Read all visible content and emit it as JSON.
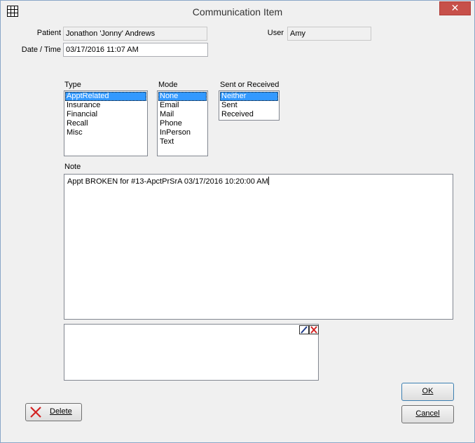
{
  "window": {
    "title": "Communication Item",
    "close_glyph": "✕"
  },
  "patient": {
    "label": "Patient",
    "value": "Jonathon 'Jonny' Andrews"
  },
  "user": {
    "label": "User",
    "value": "Amy"
  },
  "datetime": {
    "label": "Date / Time",
    "value": "03/17/2016  11:07 AM"
  },
  "type": {
    "label": "Type",
    "options": [
      "ApptRelated",
      "Insurance",
      "Financial",
      "Recall",
      "Misc"
    ],
    "selected": "ApptRelated"
  },
  "mode": {
    "label": "Mode",
    "options": [
      "None",
      "Email",
      "Mail",
      "Phone",
      "InPerson",
      "Text"
    ],
    "selected": "None"
  },
  "sent_received": {
    "label": "Sent or Received",
    "options": [
      "Neither",
      "Sent",
      "Received"
    ],
    "selected": "Neither"
  },
  "note": {
    "label": "Note",
    "value": "Appt BROKEN for #13-ApctPrSrA  03/17/2016 10:20:00 AM"
  },
  "buttons": {
    "ok": "OK",
    "cancel": "Cancel",
    "delete": "Delete"
  },
  "icons": {
    "app": "grid-icon",
    "pencil": "pencil-icon",
    "clear": "clear-x-icon",
    "delete": "delete-x-icon"
  },
  "colors": {
    "selection": "#3399ff",
    "close": "#c7504a",
    "delete_x": "#d22222"
  }
}
